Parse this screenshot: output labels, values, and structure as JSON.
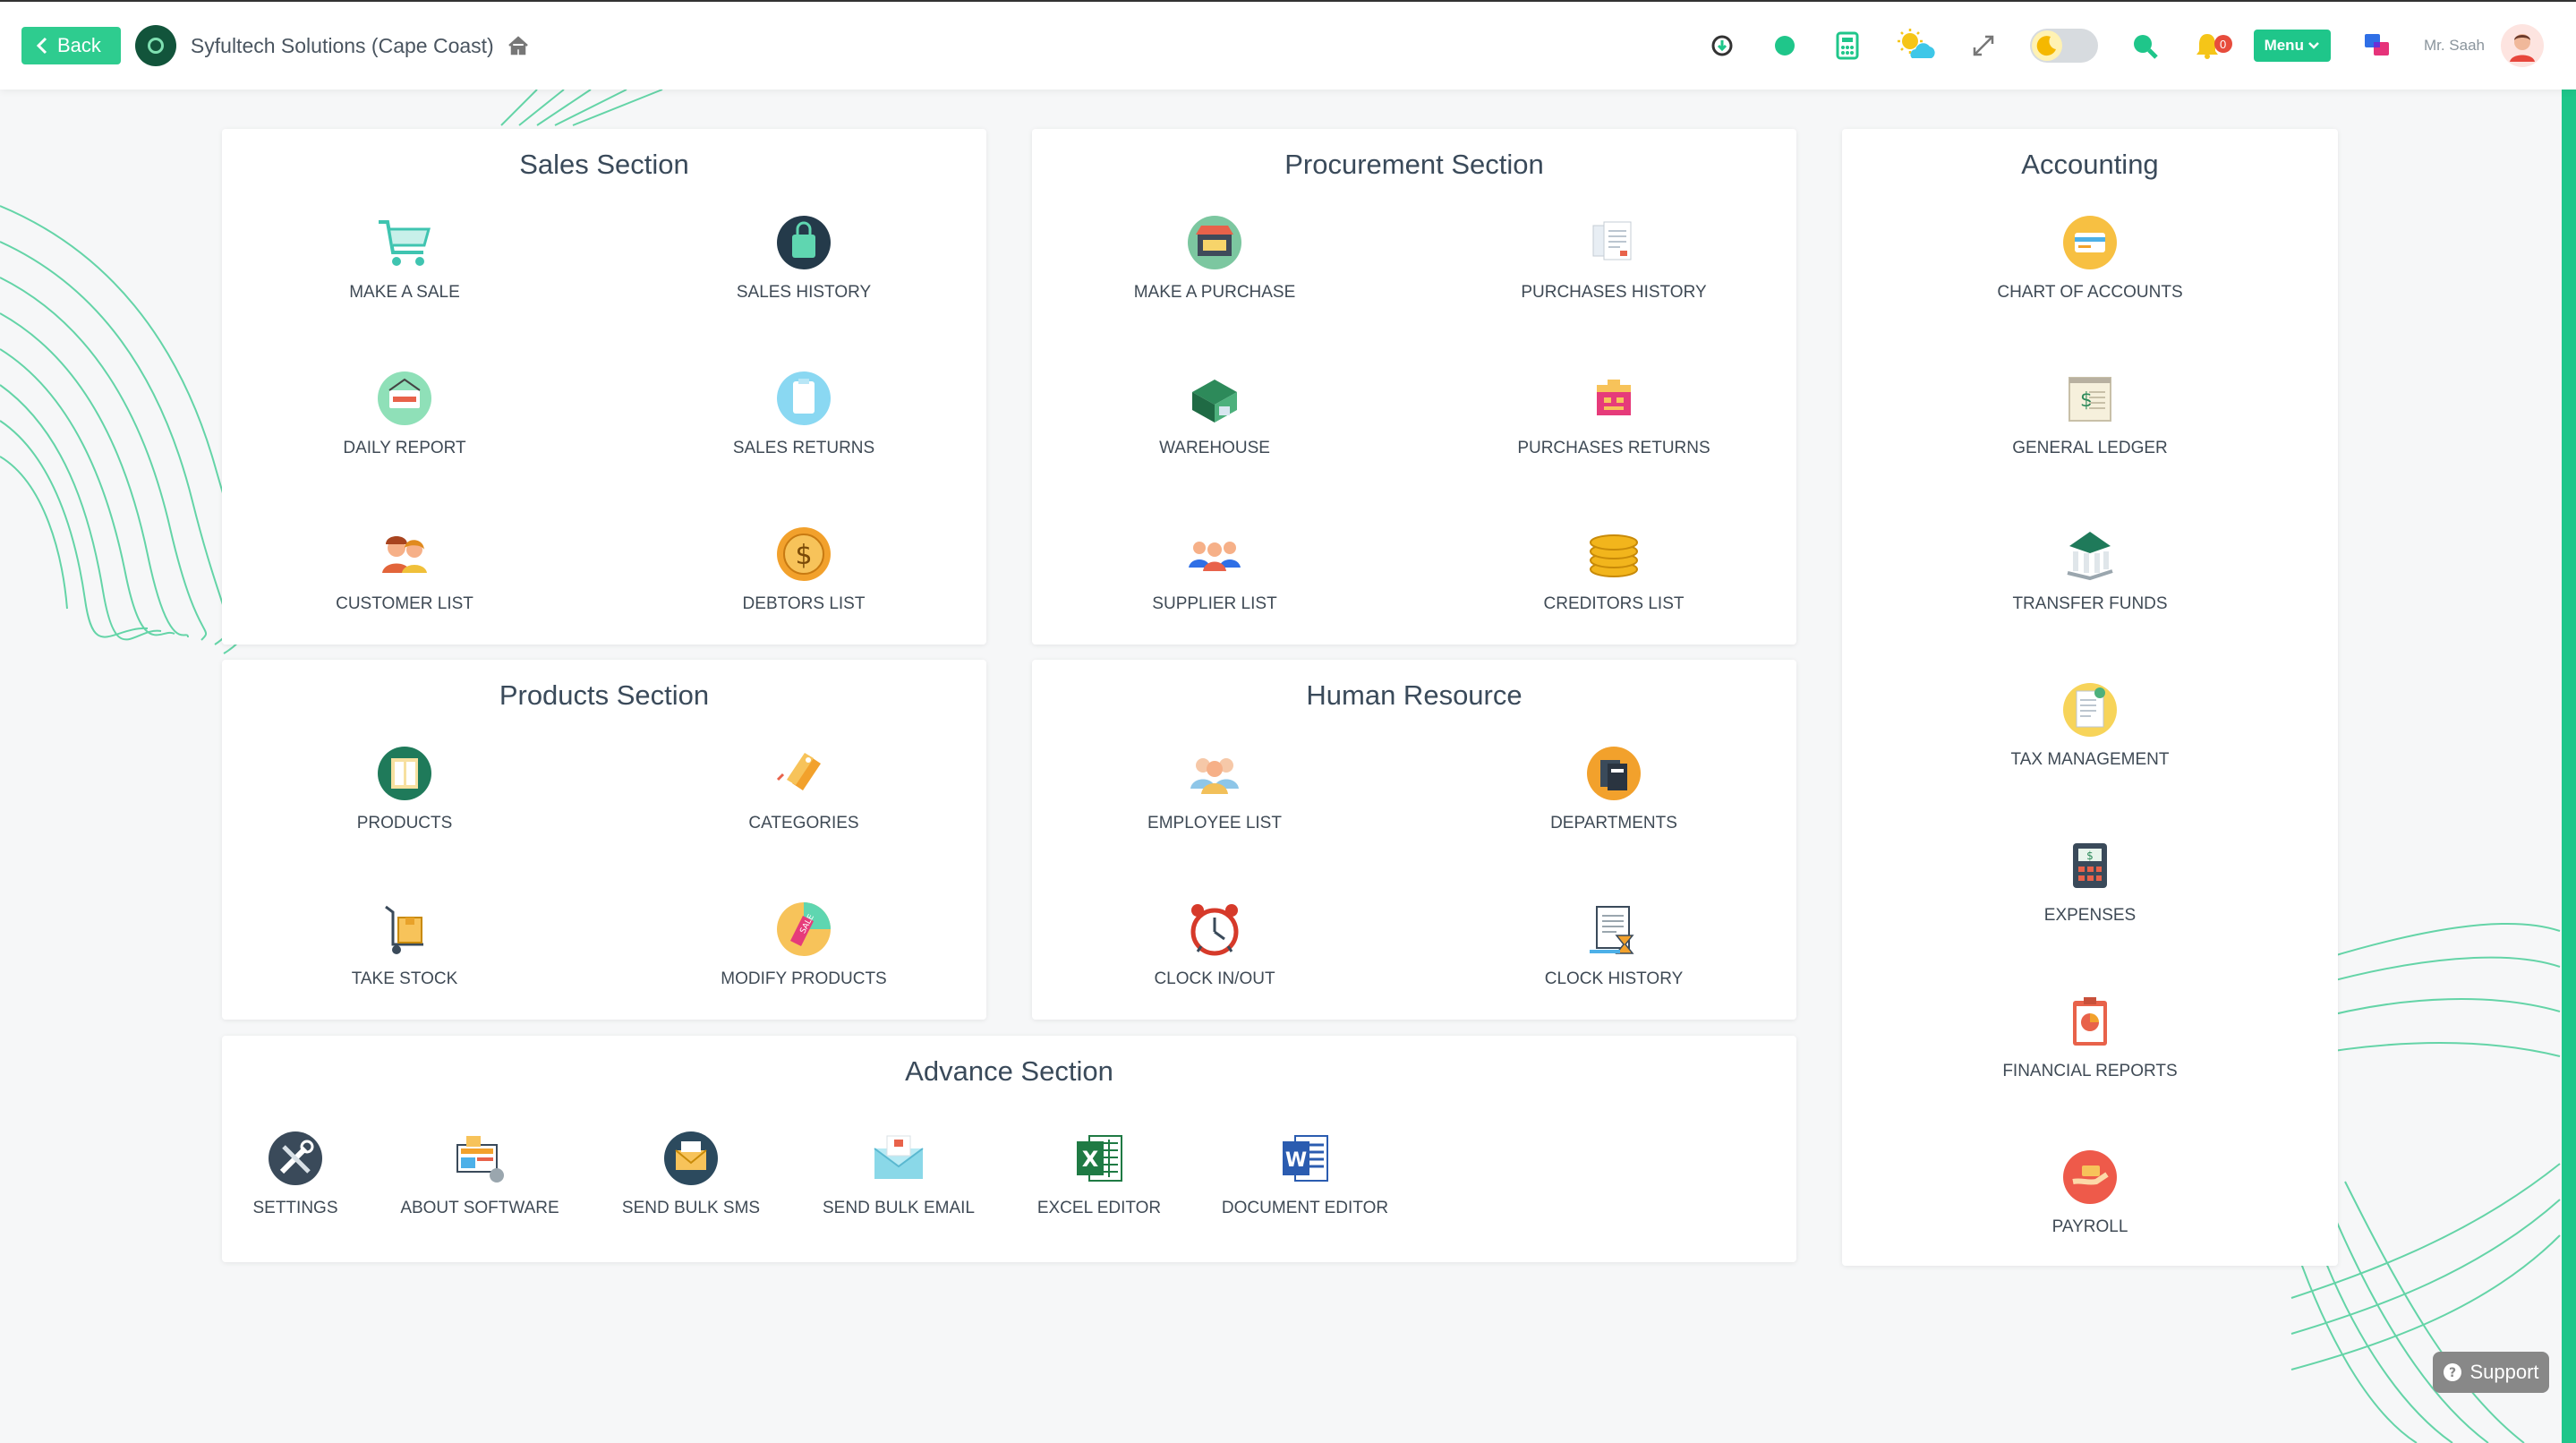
{
  "header": {
    "back_label": "Back",
    "company_name": "Syfultech Solutions (Cape Coast)",
    "menu_label": "Menu",
    "user_name": "Mr. Saah",
    "notification_count": "0"
  },
  "sales": {
    "title": "Sales Section",
    "items": [
      "MAKE A SALE",
      "SALES HISTORY",
      "DAILY REPORT",
      "SALES RETURNS",
      "CUSTOMER LIST",
      "DEBTORS LIST"
    ]
  },
  "procurement": {
    "title": "Procurement Section",
    "items": [
      "MAKE A PURCHASE",
      "PURCHASES HISTORY",
      "WAREHOUSE",
      "PURCHASES RETURNS",
      "SUPPLIER LIST",
      "CREDITORS LIST"
    ]
  },
  "accounting": {
    "title": "Accounting",
    "items": [
      "CHART OF ACCOUNTS",
      "GENERAL LEDGER",
      "TRANSFER FUNDS",
      "TAX MANAGEMENT",
      "EXPENSES",
      "FINANCIAL REPORTS",
      "PAYROLL"
    ]
  },
  "products": {
    "title": "Products Section",
    "items": [
      "PRODUCTS",
      "CATEGORIES",
      "TAKE STOCK",
      "MODIFY PRODUCTS"
    ]
  },
  "hr": {
    "title": "Human Resource",
    "items": [
      "EMPLOYEE LIST",
      "DEPARTMENTS",
      "CLOCK IN/OUT",
      "CLOCK HISTORY"
    ]
  },
  "advance": {
    "title": "Advance Section",
    "items": [
      "SETTINGS",
      "ABOUT SOFTWARE",
      "SEND BULK SMS",
      "SEND BULK EMAIL",
      "EXCEL EDITOR",
      "DOCUMENT EDITOR"
    ]
  },
  "support_label": "Support",
  "colors": {
    "accent": "#1fc68a",
    "back_button": "#2ecc8f"
  }
}
